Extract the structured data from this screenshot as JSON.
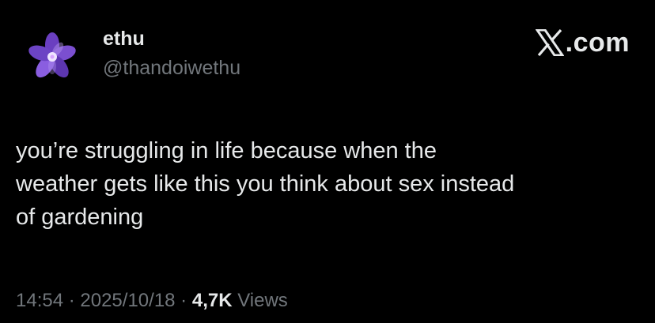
{
  "author": {
    "display_name": "ethu",
    "handle": "@thandoiwethu",
    "avatar_icon": "purple-flower-avatar"
  },
  "watermark": {
    "logo_icon": "x-logo-icon",
    "text": ".com"
  },
  "tweet": {
    "text": "you’re struggling in life because when the\nweather gets like this you think about sex instead\nof gardening"
  },
  "meta": {
    "time": "14:54",
    "separator": " · ",
    "date": "2025/10/18",
    "views_count": "4,7K",
    "views_label": " Views"
  },
  "colors": {
    "background": "#000000",
    "primary_text": "#e7e9ea",
    "secondary_text": "#71767b",
    "avatar_petal": "#7b4fc8"
  }
}
